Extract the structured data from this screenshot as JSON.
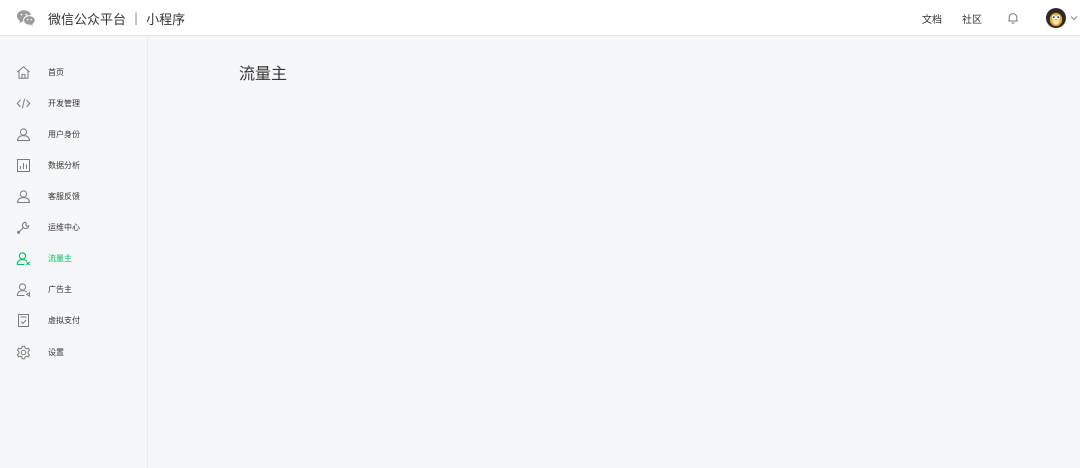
{
  "header": {
    "brand": "微信公众平台",
    "separator": "|",
    "product": "小程序",
    "links": {
      "docs": "文档",
      "community": "社区"
    }
  },
  "sidebar": {
    "active_color": "#07c160",
    "items": [
      {
        "label": "首页",
        "icon": "home-icon"
      },
      {
        "label": "开发管理",
        "icon": "code-icon"
      },
      {
        "label": "用户身份",
        "icon": "user-icon"
      },
      {
        "label": "数据分析",
        "icon": "chart-icon"
      },
      {
        "label": "客服反馈",
        "icon": "support-icon"
      },
      {
        "label": "运维中心",
        "icon": "wrench-icon"
      },
      {
        "label": "流量主",
        "icon": "traffic-host-icon",
        "active": true
      },
      {
        "label": "广告主",
        "icon": "advertiser-icon"
      },
      {
        "label": "虚拟支付",
        "icon": "virtual-payment-icon"
      },
      {
        "label": "设置",
        "icon": "gear-icon"
      }
    ]
  },
  "main": {
    "title": "流量主"
  }
}
